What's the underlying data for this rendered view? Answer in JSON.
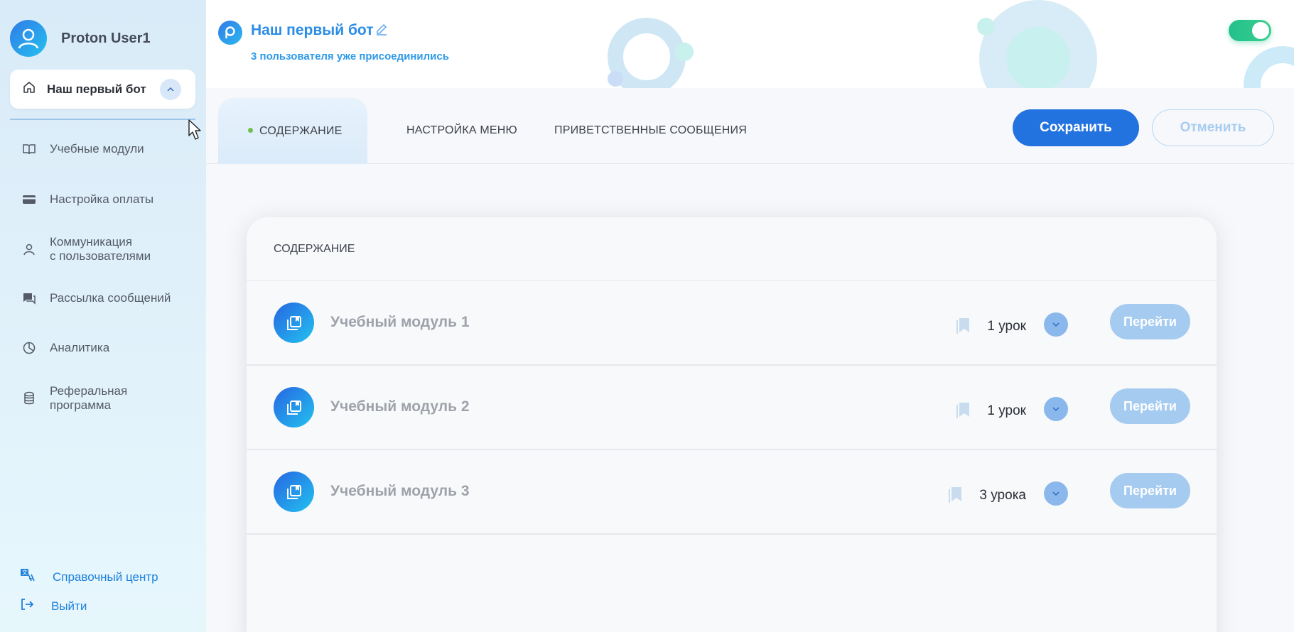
{
  "user": {
    "name": "Proton User1",
    "avatar_icon": "user-icon"
  },
  "sidebar": {
    "current_bot": "Наш первый бот",
    "items": [
      {
        "label": "Учебные модули",
        "icon": "book-icon"
      },
      {
        "label": "Настройка оплаты",
        "icon": "card-icon"
      },
      {
        "label_line1": "Коммуникация",
        "label_line2": "с пользователями",
        "icon": "person-icon"
      },
      {
        "label": "Рассылка сообщений",
        "icon": "chat-icon"
      },
      {
        "label": "Аналитика",
        "icon": "pie-chart-icon"
      },
      {
        "label_line1": "Реферальная",
        "label_line2": "программа",
        "icon": "database-icon"
      }
    ],
    "footer": [
      {
        "label": "Справочный центр",
        "icon": "translate-icon"
      },
      {
        "label": "Выйти",
        "icon": "logout-icon"
      }
    ]
  },
  "header": {
    "bot_name": "Наш первый бот",
    "subtitle": "3 пользователя уже присоединились",
    "toggle_on": true
  },
  "tabs": [
    {
      "label": "СОДЕРЖАНИЕ",
      "active": true
    },
    {
      "label": "НАСТРОЙКА МЕНЮ",
      "active": false
    },
    {
      "label": "ПРИВЕТСТВЕННЫЕ СООБЩЕНИЯ",
      "active": false
    }
  ],
  "actions": {
    "save": "Сохранить",
    "cancel": "Отменить"
  },
  "content": {
    "heading": "СОДЕРЖАНИЕ",
    "modules": [
      {
        "title": "Учебный модуль 1",
        "lessons": "1 урок",
        "go": "Перейти"
      },
      {
        "title": "Учебный модуль 2",
        "lessons": "1 урок",
        "go": "Перейти"
      },
      {
        "title": "Учебный модуль 3",
        "lessons": "3 урока",
        "go": "Перейти"
      }
    ]
  },
  "colors": {
    "primary": "#2272e0",
    "accent": "#2a8ce6",
    "toggle": "#22c08a",
    "muted_button": "#a5cbf0"
  }
}
